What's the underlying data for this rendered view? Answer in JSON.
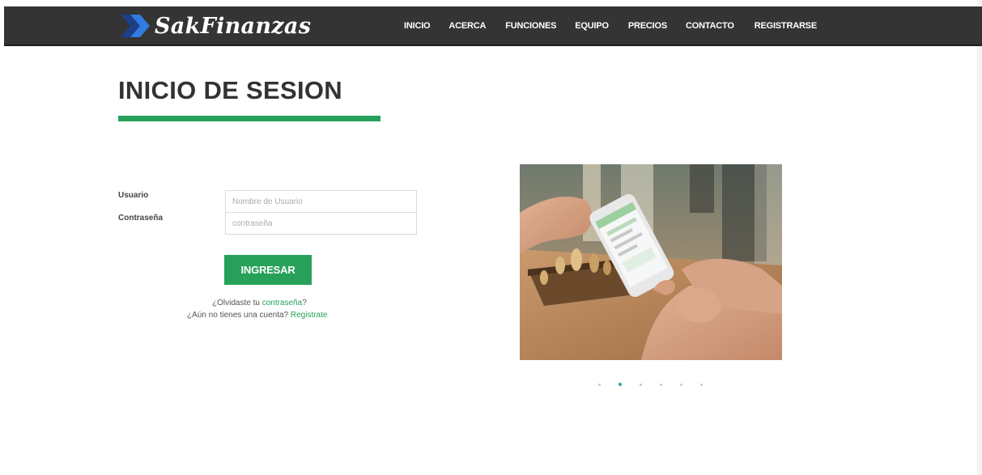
{
  "brand": {
    "name": "SakFinanzas",
    "icon": "double-chevron-arrow-icon",
    "colors": {
      "arrow_dark": "#1d3f8a",
      "arrow_light": "#2f7be0"
    }
  },
  "nav": {
    "items": [
      {
        "label": "INICIO"
      },
      {
        "label": "ACERCA"
      },
      {
        "label": "FUNCIONES"
      },
      {
        "label": "EQUIPO"
      },
      {
        "label": "PRECIOS"
      },
      {
        "label": "CONTACTO"
      },
      {
        "label": "REGISTRARSE"
      }
    ]
  },
  "page": {
    "title": "INICIO DE SESION"
  },
  "form": {
    "username_label": "Usuario",
    "username_placeholder": "Nombre de Usuario",
    "password_label": "Contraseña",
    "password_placeholder": "contraseña",
    "submit_label": "INGRESAR"
  },
  "help": {
    "forgot_prefix": "¿Olvidaste tu ",
    "forgot_link": "contraseña",
    "forgot_suffix": "?",
    "register_prefix": "¿Aún no tienes una cuenta? ",
    "register_link": "Registrate"
  },
  "carousel": {
    "image": "person-using-phone-with-chess-board-photo",
    "slide_count": 6,
    "active_slide": 2
  },
  "colors": {
    "navbar_bg": "#343434",
    "accent_green": "#27a15a",
    "active_dot": "#2aa6a6",
    "title_text": "#333333"
  }
}
